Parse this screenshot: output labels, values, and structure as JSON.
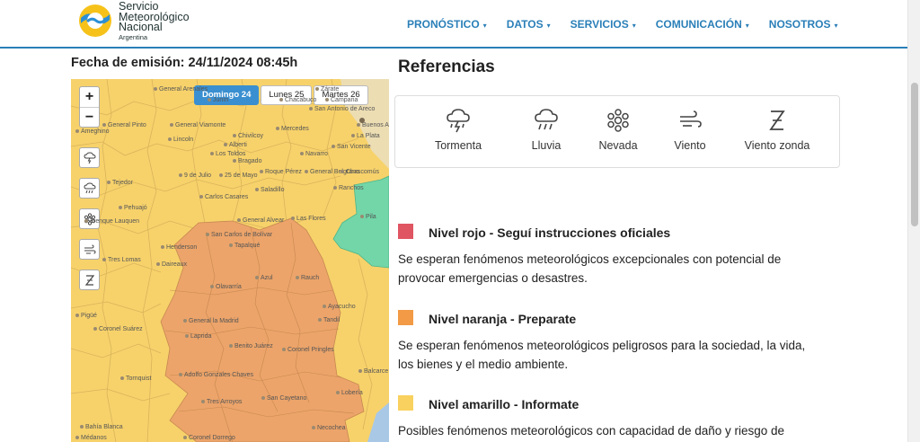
{
  "header": {
    "logo_line1": "Servicio",
    "logo_line2": "Meteorológico",
    "logo_line3": "Nacional",
    "logo_line4": "Argentina",
    "nav": [
      "PRONÓSTICO",
      "DATOS",
      "SERVICIOS",
      "COMUNICACIÓN",
      "NOSOTROS"
    ]
  },
  "emision": "Fecha de emisión: 24/11/2024 08:45h",
  "map": {
    "zoom_in": "+",
    "zoom_out": "−",
    "tabs": [
      "Domingo 24",
      "Lunes 25",
      "Martes 26"
    ],
    "active_tab": 0,
    "towns": [
      "General Arenales",
      "Junín",
      "Chacabuco",
      "San Antonio de Areco",
      "Campana",
      "Zárate",
      "Buenos Aires",
      "La Plata",
      "General Pinto",
      "General Viamonte",
      "Chivilcoy",
      "Mercedes",
      "Lincoln",
      "Alberti",
      "Navarro",
      "San Vicente",
      "Los Toldos",
      "Ameghino",
      "Bragado",
      "General Belgrano",
      "9 de Julio",
      "25 de Mayo",
      "Roque Pérez",
      "Chascomús",
      "Tejedor",
      "Carlos Casares",
      "Saladillo",
      "Ranchos",
      "Pehuajó",
      "Trenque Lauquen",
      "General Alvear",
      "Las Flores",
      "Pila",
      "San Carlos de Bolívar",
      "Tapalqué",
      "Henderson",
      "Daireaux",
      "Tres Lomas",
      "Olavarría",
      "Azul",
      "Rauch",
      "Ayacucho",
      "Pigüé",
      "General la Madrid",
      "Tandil",
      "Coronel Suárez",
      "Laprida",
      "Benito Juárez",
      "Coronel Pringles",
      "Tornquist",
      "Adolfo Gonzales Chaves",
      "Balcarce",
      "Lobería",
      "San Cayetano",
      "Tres Arroyos",
      "Necochea",
      "Bahía Blanca",
      "Coronel Dorrego",
      "Médanos"
    ]
  },
  "references": {
    "title": "Referencias",
    "items": [
      "Tormenta",
      "Lluvia",
      "Nevada",
      "Viento",
      "Viento zonda"
    ]
  },
  "levels": [
    {
      "title": "Nivel rojo - Seguí instrucciones oficiales",
      "desc": "Se esperan fenómenos meteorológicos excepcionales con potencial de provocar emergencias o desastres.",
      "color": "#e05562"
    },
    {
      "title": "Nivel naranja - Preparate",
      "desc": "Se esperan fenómenos meteorológicos peligrosos para la sociedad, la vida, los bienes y el medio ambiente.",
      "color": "#f29a45"
    },
    {
      "title": "Nivel amarillo - Informate",
      "desc": "Posibles fenómenos meteorológicos con capacidad de daño y riesgo de",
      "color": "#f9d15e"
    }
  ]
}
